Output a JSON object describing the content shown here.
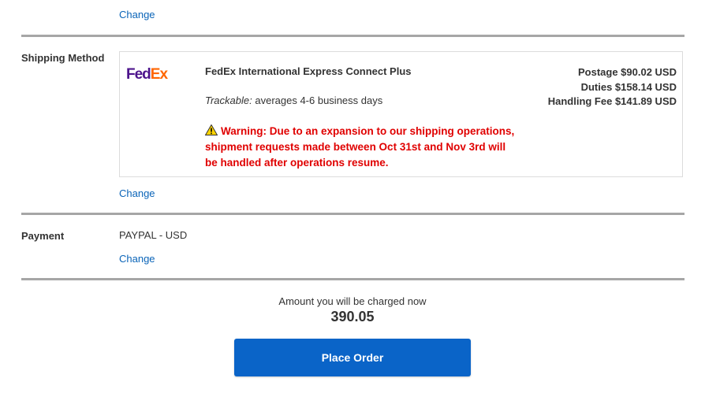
{
  "top": {
    "change_label": "Change"
  },
  "shipping": {
    "section_label": "Shipping Method",
    "logo_fed": "Fed",
    "logo_ex": "Ex",
    "method_name": "FedEx International Express Connect Plus",
    "trackable_label": "Trackable:",
    "trackable_text": "averages 4-6 business days",
    "warning_text": "Warning: Due to an expansion to our shipping operations, shipment requests made between Oct 31st and Nov 3rd will be handled after operations resume.",
    "postage": "Postage $90.02 USD",
    "duties": "Duties $158.14 USD",
    "handling_fee": "Handling Fee $141.89 USD",
    "change_label": "Change",
    "colors": {
      "fedex_purple": "#4d148c",
      "fedex_orange": "#ff6600",
      "warning_red": "#e00000"
    },
    "warning_icon": "warning-triangle-icon"
  },
  "payment": {
    "section_label": "Payment",
    "value": "PAYPAL - USD",
    "change_label": "Change"
  },
  "summary": {
    "charge_label": "Amount you will be charged now",
    "charge_amount": "390.05",
    "place_order_label": "Place Order",
    "button_color": "#0a64c8"
  }
}
